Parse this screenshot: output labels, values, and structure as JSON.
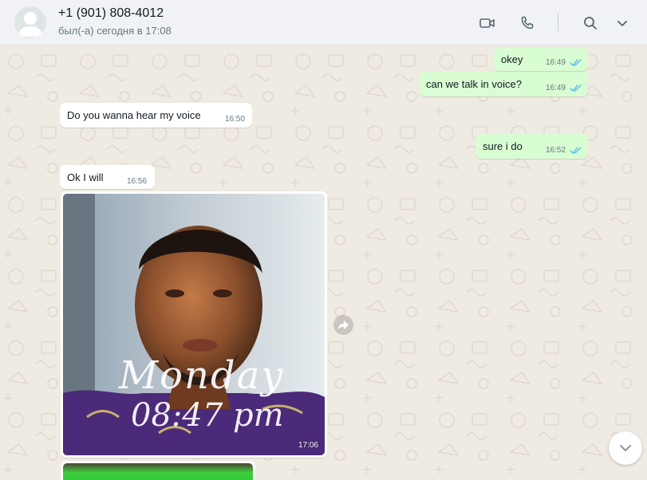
{
  "header": {
    "contact_name": "+1 (901) 808-4012",
    "last_seen": "был(-а) сегодня в 17:08",
    "icons": [
      "video-call-icon",
      "voice-call-icon",
      "search-icon",
      "chevron-down-icon"
    ]
  },
  "messages": [
    {
      "direction": "out",
      "text": "okey",
      "time": "16:49",
      "status": "read"
    },
    {
      "direction": "out",
      "text": "can we talk in voice?",
      "time": "16:49",
      "status": "read"
    },
    {
      "direction": "in",
      "text": "Do you wanna hear my voice",
      "time": "16:50"
    },
    {
      "direction": "out",
      "text": "sure i do",
      "time": "16:52",
      "status": "read"
    },
    {
      "direction": "in",
      "text": "Ok I will",
      "time": "16:56"
    },
    {
      "direction": "in",
      "type": "image",
      "time": "17:06",
      "overlay_day": "Monday",
      "overlay_time": "08:47 pm"
    }
  ],
  "colors": {
    "outgoing_bubble": "#d9fdd3",
    "incoming_bubble": "#ffffff",
    "read_ticks": "#53bdeb",
    "chat_background": "#efeae2"
  }
}
